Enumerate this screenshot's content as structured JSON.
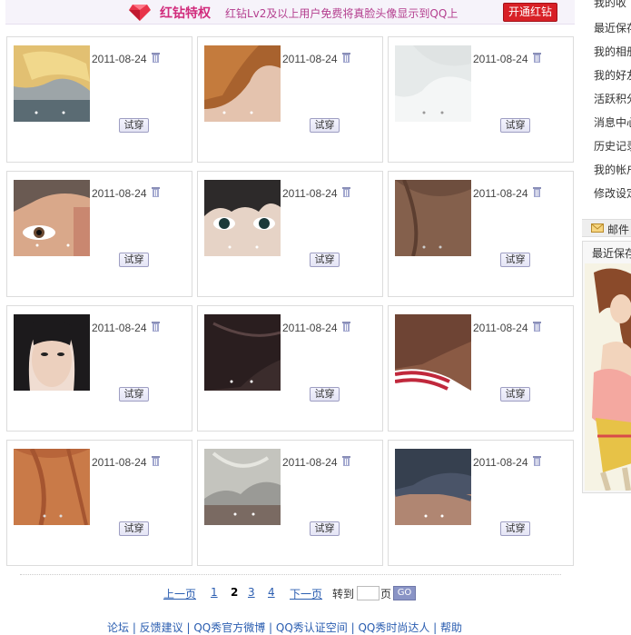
{
  "banner": {
    "title": "红钻特权",
    "description": "红钻Lv2及以上用户免费将真脸头像显示到QQ上",
    "button": "开通红钻"
  },
  "cards": [
    {
      "date": "2011-08-24",
      "try_label": "试穿",
      "hair": "blonde"
    },
    {
      "date": "2011-08-24",
      "try_label": "试穿",
      "hair": "auburn"
    },
    {
      "date": "2011-08-24",
      "try_label": "试穿",
      "hair": "white"
    },
    {
      "date": "2011-08-24",
      "try_label": "试穿",
      "hair": "buzz"
    },
    {
      "date": "2011-08-24",
      "try_label": "试穿",
      "hair": "dark-bangs"
    },
    {
      "date": "2011-08-24",
      "try_label": "试穿",
      "hair": "brown"
    },
    {
      "date": "2011-08-24",
      "try_label": "试穿",
      "hair": "black-long"
    },
    {
      "date": "2011-08-24",
      "try_label": "试穿",
      "hair": "dark-brown"
    },
    {
      "date": "2011-08-24",
      "try_label": "试穿",
      "hair": "striped"
    },
    {
      "date": "2011-08-24",
      "try_label": "试穿",
      "hair": "copper"
    },
    {
      "date": "2011-08-24",
      "try_label": "试穿",
      "hair": "silver"
    },
    {
      "date": "2011-08-24",
      "try_label": "试穿",
      "hair": "navy"
    }
  ],
  "sidebar": {
    "links": [
      "我的收",
      "最近保存",
      "我的相册",
      "我的好友",
      "活跃积分",
      "消息中心",
      "历史记录",
      "我的帐户",
      "修改设定"
    ],
    "mail_label": "邮件",
    "recent_label": "最近保存"
  },
  "pager": {
    "prev": "上一页",
    "pages": [
      "1",
      "2",
      "3",
      "4"
    ],
    "current": "2",
    "next": "下一页",
    "goto": "转到",
    "page_unit": "页",
    "go": "GO"
  },
  "footer": "论坛 | 反馈建议 | QQ秀官方微博 | QQ秀认证空间 | QQ秀时尚达人 | 帮助"
}
